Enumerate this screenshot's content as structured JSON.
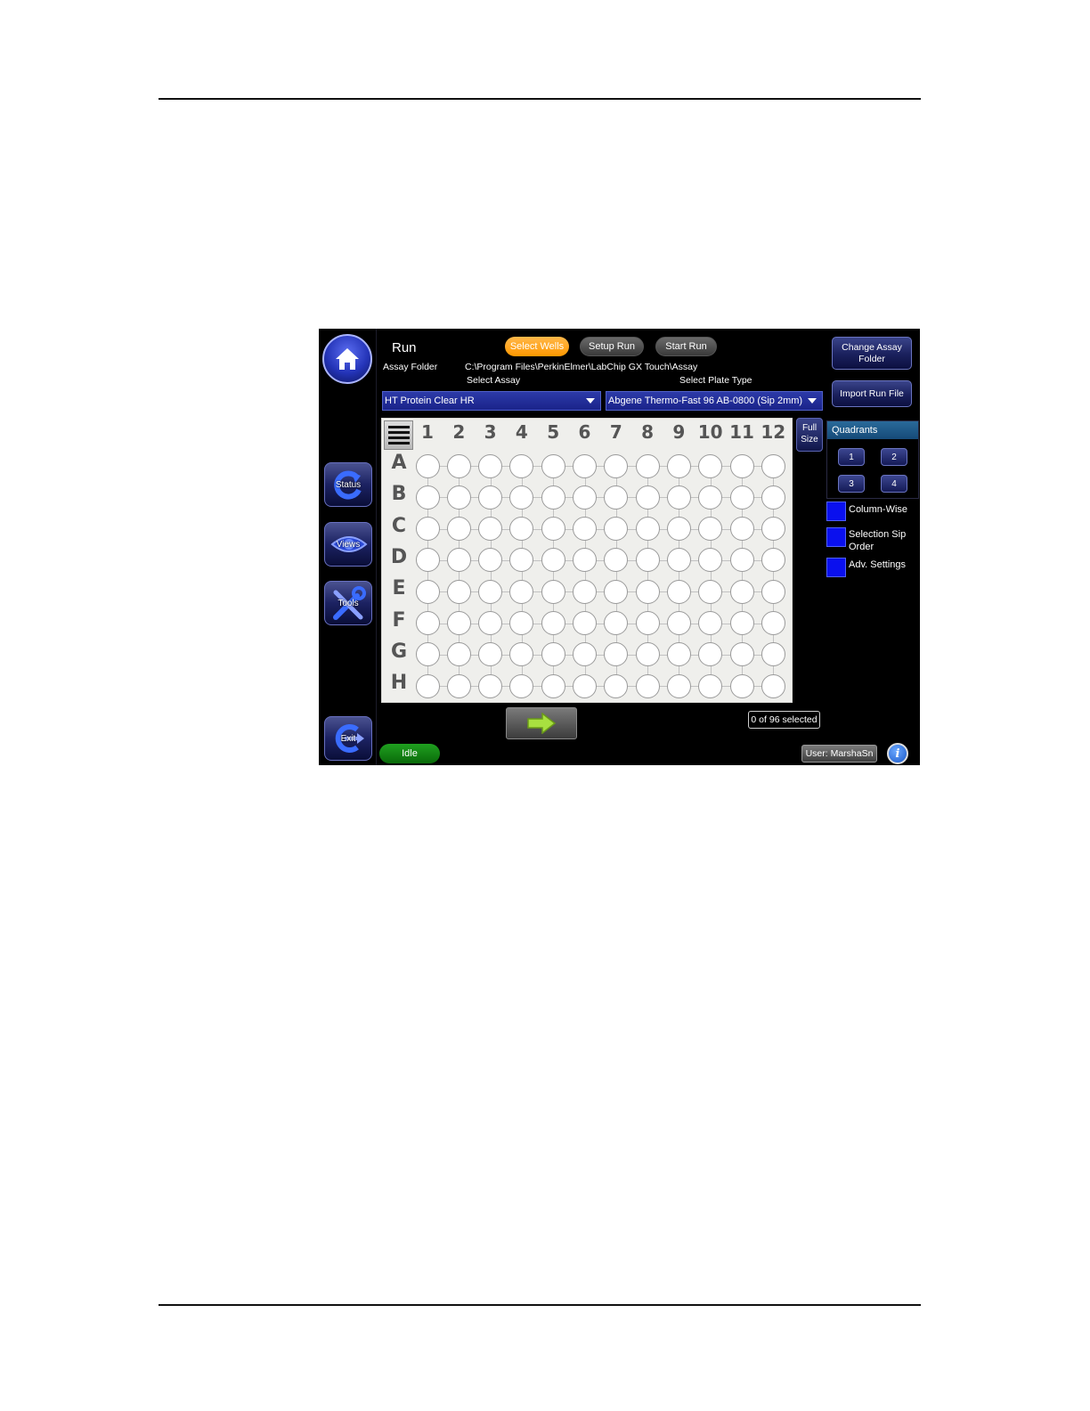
{
  "sidebar": {
    "status_label": "Status",
    "views_label": "Views",
    "tools_label": "Tools",
    "exit_label": "Exit"
  },
  "header": {
    "title": "Run",
    "tabs": [
      {
        "label": "Select Wells",
        "active": true
      },
      {
        "label": "Setup Run",
        "active": false
      },
      {
        "label": "Start Run",
        "active": false
      }
    ],
    "assay_folder_label": "Assay Folder",
    "assay_folder_path": "C:\\Program Files\\PerkinElmer\\LabChip GX Touch\\Assay",
    "select_assay_label": "Select Assay",
    "select_plate_type_label": "Select Plate Type",
    "assay_value": "HT Protein Clear HR",
    "plate_type_value": "Abgene Thermo-Fast 96 AB-0800 (Sip 2mm)"
  },
  "right_panel": {
    "change_assay_folder": "Change Assay Folder",
    "import_run_file": "Import Run File",
    "full_size": "Full Size",
    "quadrants_title": "Quadrants",
    "quadrant_buttons": [
      "1",
      "2",
      "3",
      "4"
    ],
    "column_wise": "Column-Wise",
    "selection_sip_order": "Selection Sip Order",
    "adv_settings": "Adv. Settings"
  },
  "plate": {
    "columns": [
      "1",
      "2",
      "3",
      "4",
      "5",
      "6",
      "7",
      "8",
      "9",
      "10",
      "11",
      "12"
    ],
    "rows": [
      "A",
      "B",
      "C",
      "D",
      "E",
      "F",
      "G",
      "H"
    ]
  },
  "footer": {
    "selection_count": "0 of 96 selected",
    "status": "Idle",
    "user": "User: MarshaSn"
  },
  "colors": {
    "active_tab": "#ff9800",
    "status_idle": "#1a8a1a",
    "checkbox": "#0a10ee",
    "dropdown": "#1f2a96"
  }
}
